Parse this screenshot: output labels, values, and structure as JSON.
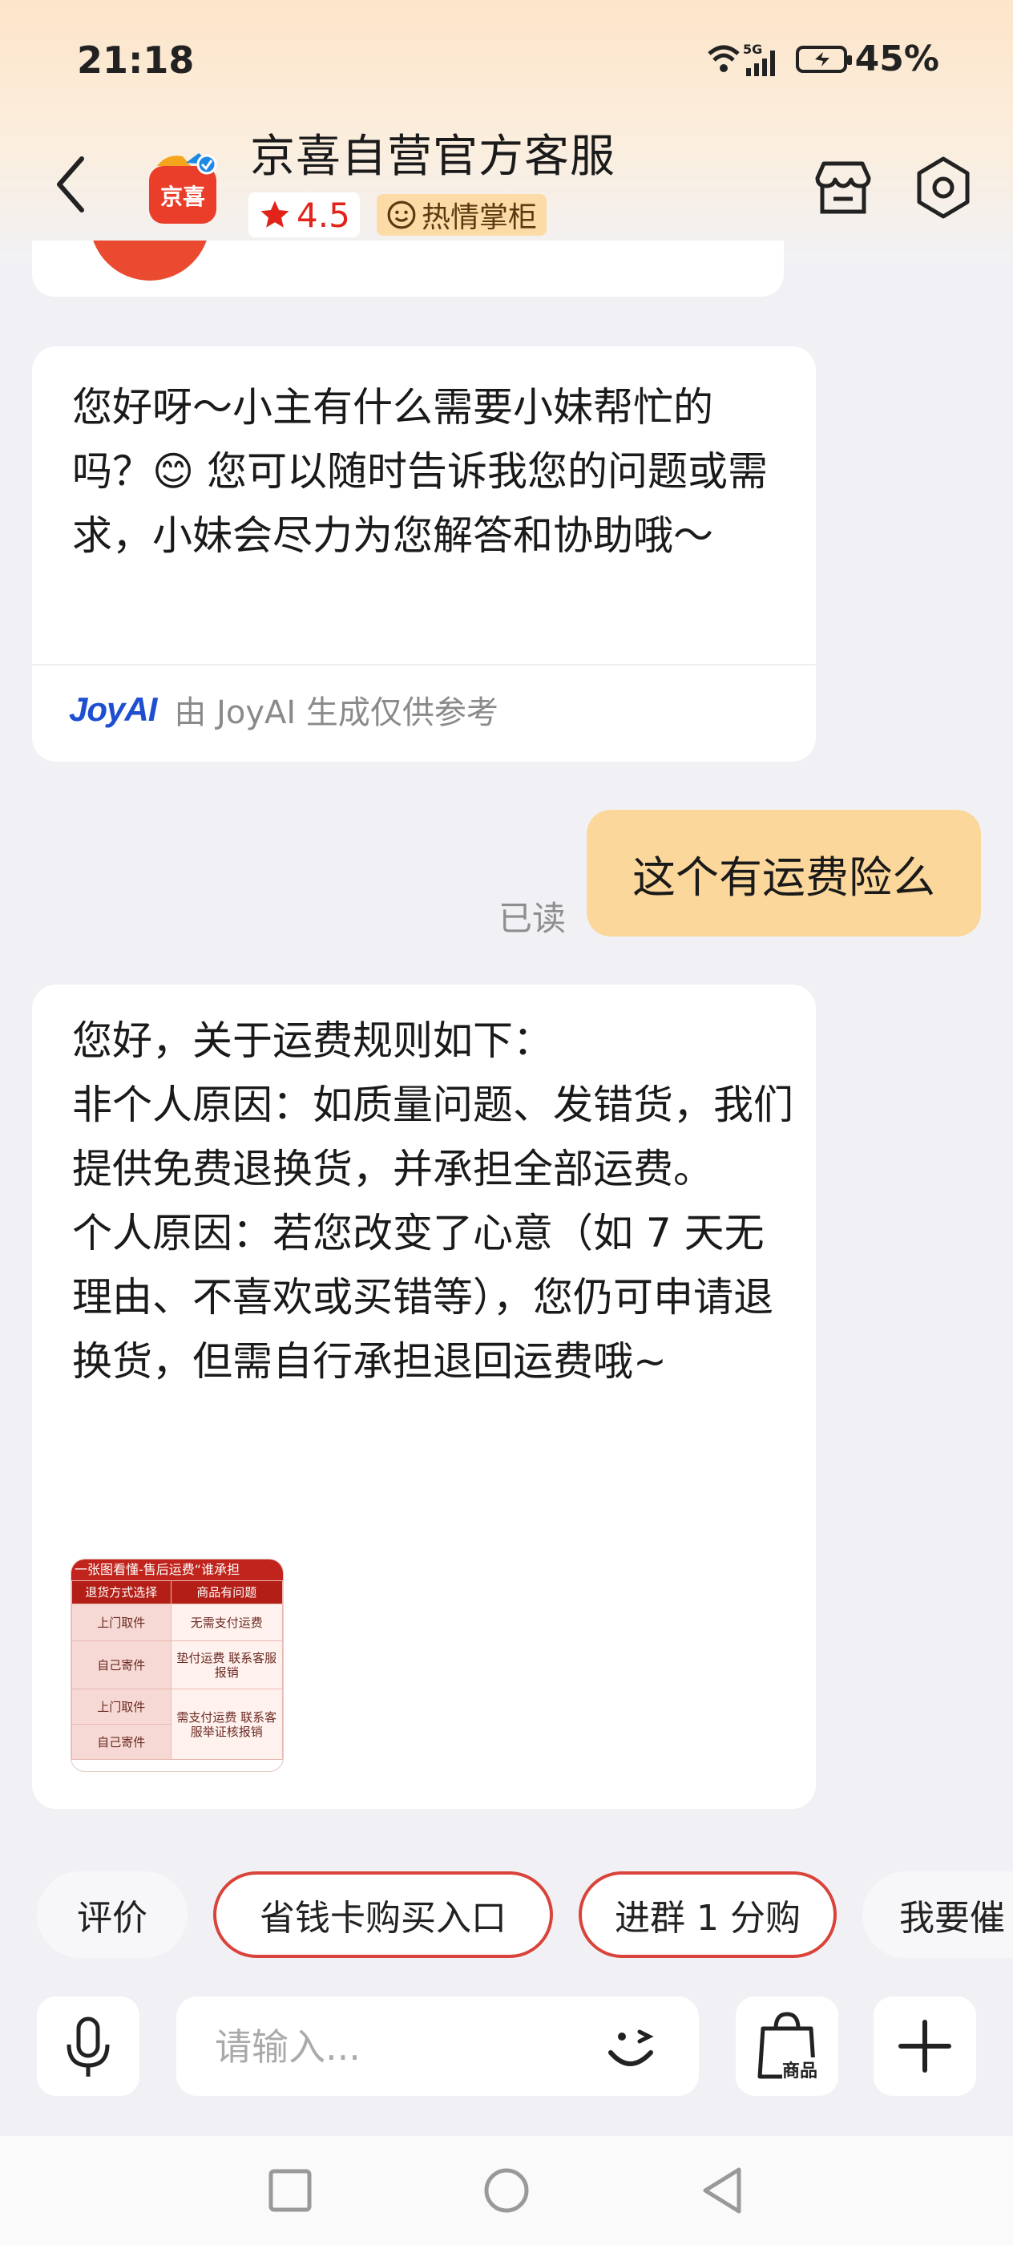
{
  "status_bar": {
    "time": "21:18",
    "signal_label": "5G",
    "battery": "45%"
  },
  "header": {
    "shop_name": "京喜自营官方客服",
    "logo_text": "京喜",
    "rating": "4.5",
    "badge": "热情掌柜"
  },
  "messages": {
    "greeting": "您好呀～小主有什么需要小妹帮忙的吗？😊 您可以随时告诉我您的问题或需求，小妹会尽力为您解答和协助哦～",
    "joyai_logo": "JoyAI",
    "joyai_note": "由 JoyAI 生成仅供参考",
    "read_status": "已读",
    "user_question": "这个有运费险么",
    "reply_lines": [
      "您好，关于运费规则如下：",
      "非个人原因：如质量问题、发错货，我们提供免费退换货，并承担全部运费。",
      "个人原因：若您改变了心意（如 7 天无理由、不喜欢或买错等），您仍可申请退换货，但需自行承担退回运费哦~"
    ],
    "image": {
      "title": "一张图看懂-售后运费“谁承担",
      "header_left": "退货方式选择",
      "header_right": "商品有问题",
      "rows": [
        {
          "left": "上门取件",
          "right": "无需支付运费"
        },
        {
          "left": "自己寄件",
          "right": "垫付运费 联系客服报销"
        },
        {
          "left": "上门取件",
          "right": "需支付运费 联系客服举证核报销"
        },
        {
          "left": "自己寄件",
          "right": ""
        }
      ]
    }
  },
  "chips": [
    "评价",
    "省钱卡购买入口",
    "进群 1 分购",
    "我要催"
  ],
  "input": {
    "placeholder": "请输入...",
    "product_label": "商品"
  }
}
